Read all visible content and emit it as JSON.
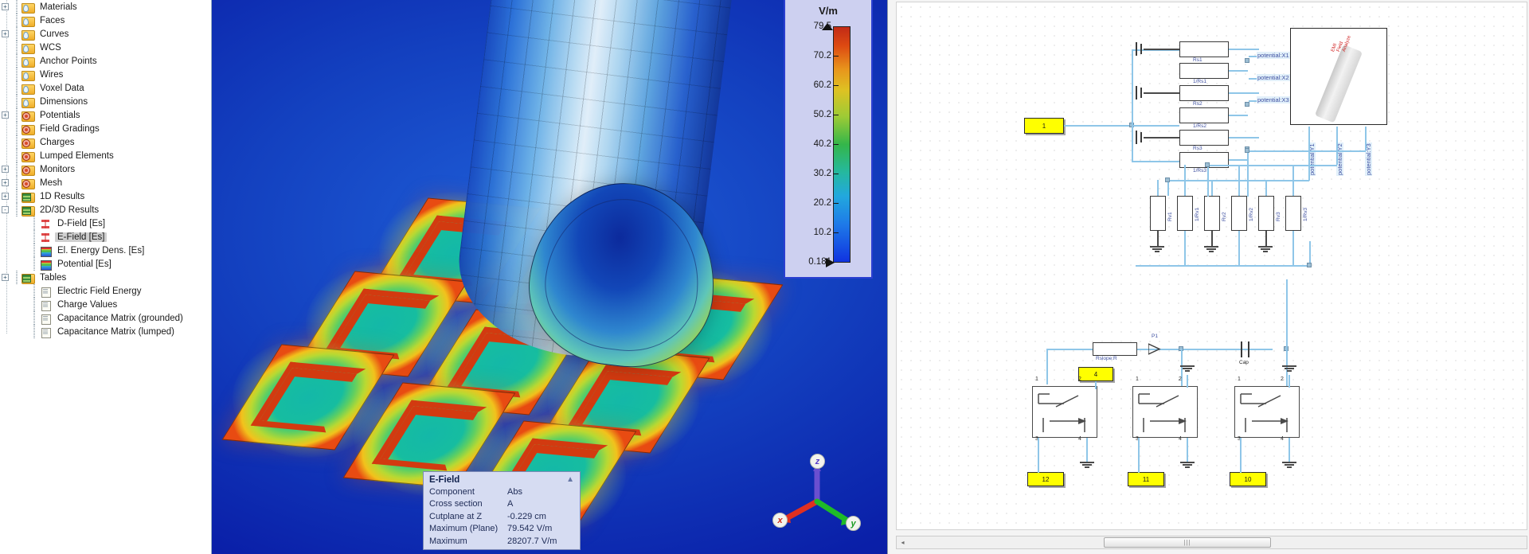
{
  "tree": {
    "items": [
      {
        "label": "Materials",
        "indent": 0,
        "expander": "+",
        "icon": "folder-icon",
        "selected": false
      },
      {
        "label": "Faces",
        "indent": 0,
        "expander": "",
        "icon": "folder-icon",
        "selected": false
      },
      {
        "label": "Curves",
        "indent": 0,
        "expander": "+",
        "icon": "folder-icon",
        "selected": false
      },
      {
        "label": "WCS",
        "indent": 0,
        "expander": "",
        "icon": "folder-icon",
        "selected": false
      },
      {
        "label": "Anchor Points",
        "indent": 0,
        "expander": "",
        "icon": "folder-icon",
        "selected": false
      },
      {
        "label": "Wires",
        "indent": 0,
        "expander": "",
        "icon": "folder-icon",
        "selected": false
      },
      {
        "label": "Voxel Data",
        "indent": 0,
        "expander": "",
        "icon": "folder-icon",
        "selected": false
      },
      {
        "label": "Dimensions",
        "indent": 0,
        "expander": "",
        "icon": "folder-icon",
        "selected": false
      },
      {
        "label": "Potentials",
        "indent": 0,
        "expander": "+",
        "icon": "folder-gear-icon",
        "selected": false
      },
      {
        "label": "Field Gradings",
        "indent": 0,
        "expander": "",
        "icon": "folder-gear-icon",
        "selected": false
      },
      {
        "label": "Charges",
        "indent": 0,
        "expander": "",
        "icon": "folder-gear-icon",
        "selected": false
      },
      {
        "label": "Lumped Elements",
        "indent": 0,
        "expander": "",
        "icon": "folder-gear-icon",
        "selected": false
      },
      {
        "label": "Monitors",
        "indent": 0,
        "expander": "+",
        "icon": "folder-gear-icon",
        "selected": false
      },
      {
        "label": "Mesh",
        "indent": 0,
        "expander": "+",
        "icon": "folder-gear-icon",
        "selected": false
      },
      {
        "label": "1D Results",
        "indent": 0,
        "expander": "+",
        "icon": "folder-results-icon",
        "selected": false
      },
      {
        "label": "2D/3D Results",
        "indent": 0,
        "expander": "-",
        "icon": "folder-results-icon",
        "selected": false
      },
      {
        "label": "D-Field [Es]",
        "indent": 1,
        "expander": "",
        "icon": "field-icon",
        "selected": false
      },
      {
        "label": "E-Field [Es]",
        "indent": 1,
        "expander": "",
        "icon": "field-icon",
        "selected": true
      },
      {
        "label": "El. Energy Dens. [Es]",
        "indent": 1,
        "expander": "",
        "icon": "spectrum-cube-icon",
        "selected": false
      },
      {
        "label": "Potential [Es]",
        "indent": 1,
        "expander": "",
        "icon": "spectrum-cube-icon",
        "selected": false
      },
      {
        "label": "Tables",
        "indent": 0,
        "expander": "+",
        "icon": "folder-results-icon",
        "selected": false
      },
      {
        "label": "Electric Field Energy",
        "indent": 1,
        "expander": "",
        "icon": "table-icon",
        "selected": false
      },
      {
        "label": "Charge Values",
        "indent": 1,
        "expander": "",
        "icon": "table-icon",
        "selected": false
      },
      {
        "label": "Capacitance Matrix (grounded)",
        "indent": 1,
        "expander": "",
        "icon": "table-icon",
        "selected": false
      },
      {
        "label": "Capacitance Matrix (lumped)",
        "indent": 1,
        "expander": "",
        "icon": "table-icon",
        "selected": false
      }
    ]
  },
  "legend": {
    "title": "V/m",
    "max_label": "79.5",
    "min_label": "0.181",
    "ticks": [
      "70.2",
      "60.2",
      "50.2",
      "40.2",
      "30.2",
      "20.2",
      "10.2"
    ],
    "colors": {
      "high": "#c22a16",
      "mid": "#34b64a",
      "low": "#1033e0",
      "panel_bg": "#cdd0f0",
      "panel_border": "#2a3fd0"
    }
  },
  "efield_box": {
    "title": "E-Field",
    "collapse_icon": "chevron-up-icon",
    "rows": [
      {
        "key": "Component",
        "value": "Abs"
      },
      {
        "key": "Cross section",
        "value": "A"
      },
      {
        "key": "Cutplane at Z",
        "value": "-0.229 cm"
      },
      {
        "key": "Maximum (Plane)",
        "value": "79.542 V/m"
      },
      {
        "key": "Maximum",
        "value": "28207.7 V/m"
      }
    ]
  },
  "triad": {
    "x_label": "x",
    "y_label": "y",
    "z_label": "z",
    "x_color": "#e03020",
    "y_color": "#1fbb28",
    "z_color": "#6a4fd0"
  },
  "schematic": {
    "source_port": "1",
    "resistors_top": [
      {
        "label": "Rs1"
      },
      {
        "label": "1/Rs1"
      },
      {
        "label": "Rs2"
      },
      {
        "label": "1/Rs2"
      },
      {
        "label": "Rs3"
      },
      {
        "label": "1/Rs3"
      }
    ],
    "potential_labels": [
      "potential:X1",
      "potential:X2",
      "potential:X3"
    ],
    "potential_labels_vertical": [
      "potential:Y1",
      "potential:Y2",
      "potential:Y3"
    ],
    "resistors_mid": [
      {
        "label": "Rv1"
      },
      {
        "label": "1/Rv1"
      },
      {
        "label": "Rv2"
      },
      {
        "label": "1/Rv2"
      },
      {
        "label": "Rv3"
      },
      {
        "label": "1/Rv3"
      }
    ],
    "series_block_label": "Rslope:R",
    "probe_label": "P1",
    "cap_label": "Cap",
    "switch_pins": [
      "1",
      "2",
      "3",
      "4"
    ],
    "switch_ports": [
      "12",
      "11",
      "10"
    ],
    "aux_port": "4",
    "device_texts": [
      "EMI",
      "Field",
      "Analyze"
    ]
  },
  "scrollbar": {
    "left_arrow": "◂",
    "thumb_grip": "|||"
  }
}
